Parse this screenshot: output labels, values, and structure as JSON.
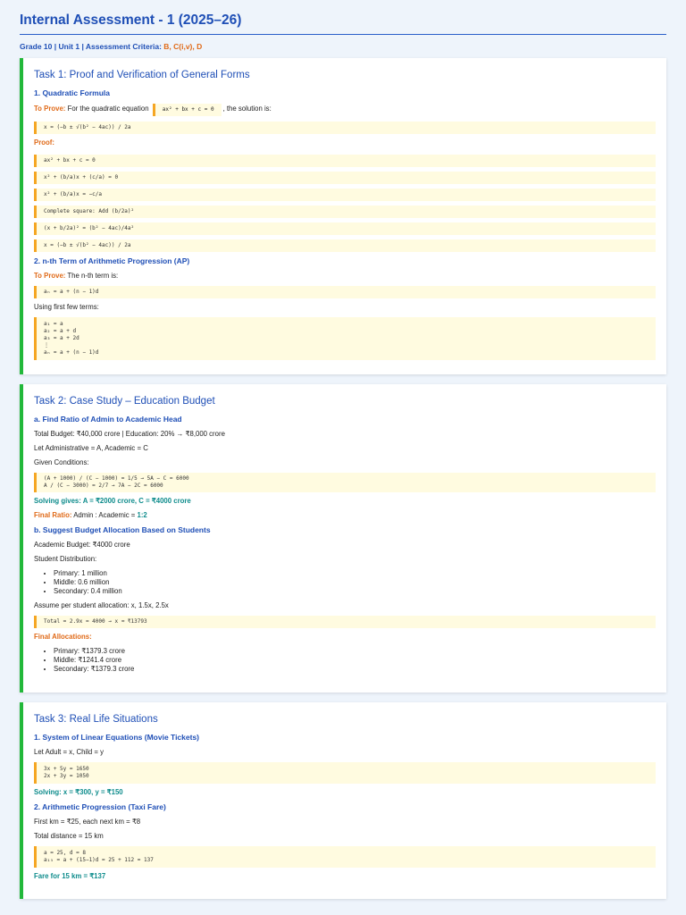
{
  "title": "Internal Assessment - 1 (2025–26)",
  "meta": {
    "prefix": "Grade 10 | Unit 1 | Assessment Criteria: ",
    "criteria": "B, C(i,v), D"
  },
  "task1": {
    "title": "Task 1: Proof and Verification of General Forms",
    "s1": {
      "heading": "1. Quadratic Formula",
      "to_prove_label": "To Prove:",
      "to_prove_text": "For the quadratic equation",
      "equation": "ax² + bx + c = 0",
      "after": ", the solution is:",
      "solution": "x = (−b ± √(b² − 4ac)) / 2a",
      "proof_label": "Proof:",
      "steps": [
        "ax² + bx + c = 0",
        "x² + (b/a)x + (c/a) = 0",
        "x² + (b/a)x = −c/a",
        "Complete square: Add (b/2a)²",
        "(x + b/2a)² = (b² − 4ac)/4a²",
        "x = (−b ± √(b² − 4ac)) / 2a"
      ]
    },
    "s2": {
      "heading": "2. n-th Term of Arithmetic Progression (AP)",
      "to_prove_label": "To Prove:",
      "to_prove_text": "The n-th term is:",
      "formula": "aₙ = a + (n − 1)d",
      "intro": "Using first few terms:",
      "terms": "a₁ = a\na₂ = a + d\na₃ = a + 2d\n⋮\naₙ = a + (n − 1)d"
    }
  },
  "task2": {
    "title": "Task 2: Case Study – Education Budget",
    "a": {
      "heading": "a. Find Ratio of Admin to Academic Head",
      "budget": "Total Budget: ₹40,000 crore | Education: 20% → ₹8,000 crore",
      "let": "Let Administrative = A, Academic = C",
      "given": "Given Conditions:",
      "conditions": "(A + 1000) / (C − 1000) = 1/5 → 5A − C = 6000\nA / (C − 3000) = 2/7 → 7A − 2C = 6000",
      "solving": "Solving gives: A = ₹2000 crore, C = ₹4000 crore",
      "final_label": "Final Ratio:",
      "final_text": "Admin : Academic =",
      "final_value": "1:2"
    },
    "b": {
      "heading": "b. Suggest Budget Allocation Based on Students",
      "academic": "Academic Budget: ₹4000 crore",
      "dist_label": "Student Distribution:",
      "dist": [
        "Primary: 1 million",
        "Middle: 0.6 million",
        "Secondary: 0.4 million"
      ],
      "assume": "Assume per student allocation: x, 1.5x, 2.5x",
      "total": "Total = 2.9x = 4000 → x ≈ ₹13793",
      "final_label": "Final Allocations:",
      "allocs": [
        "Primary: ₹1379.3 crore",
        "Middle: ₹1241.4 crore",
        "Secondary: ₹1379.3 crore"
      ]
    }
  },
  "task3": {
    "title": "Task 3: Real Life Situations",
    "s1": {
      "heading": "1. System of Linear Equations (Movie Tickets)",
      "let": "Let Adult = x, Child = y",
      "eqs": "3x + 5y = 1650\n2x + 3y = 1050",
      "solving": "Solving: x = ₹300, y = ₹150"
    },
    "s2": {
      "heading": "2. Arithmetic Progression (Taxi Fare)",
      "first": "First km = ₹25, each next km = ₹8",
      "dist": "Total distance = 15 km",
      "calc": "a = 25, d = 8\na₁₅ = a + (15−1)d = 25 + 112 = 137",
      "fare": "Fare for 15 km = ₹137"
    }
  }
}
